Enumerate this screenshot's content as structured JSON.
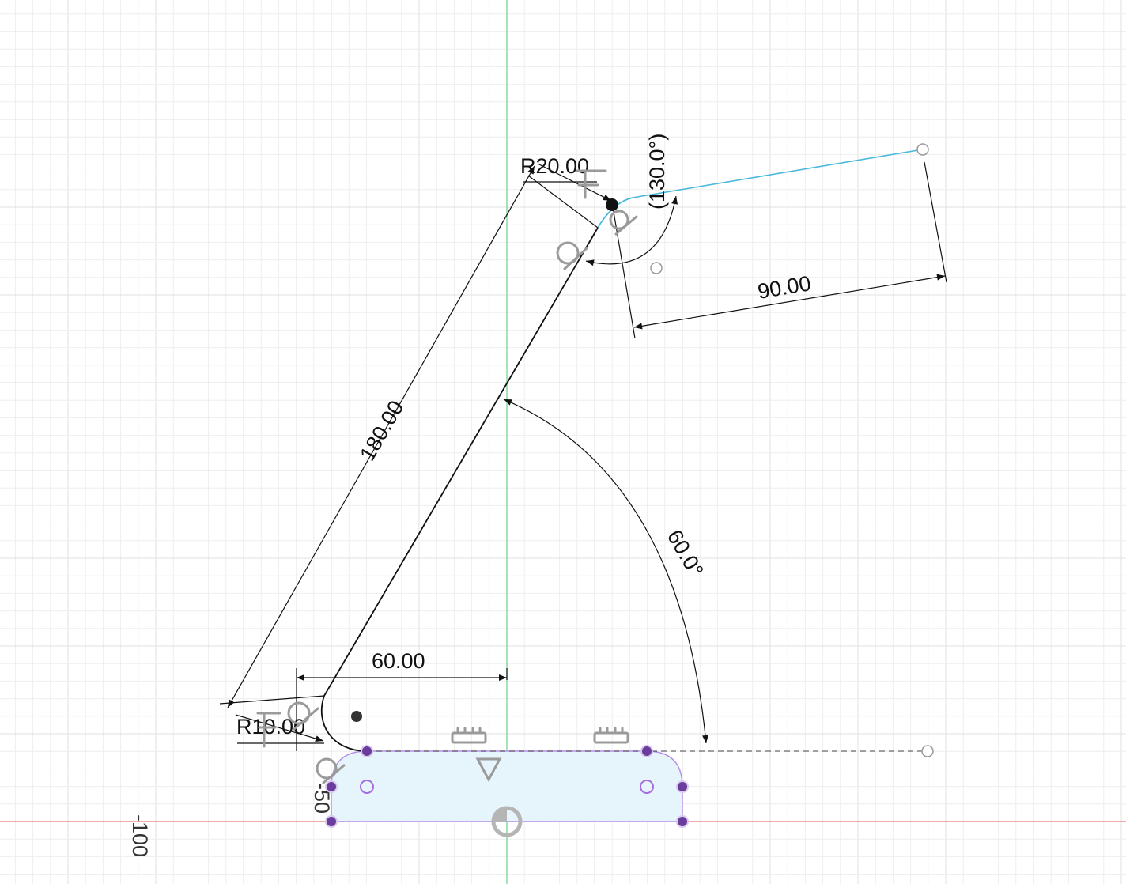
{
  "sketch": {
    "dimensions": {
      "arm_length": "180.00",
      "arm_angle": "60.0°",
      "top_angle": "(130.0°)",
      "top_radius": "R20.00",
      "bottom_radius": "R10.00",
      "offset": "60.00",
      "top_length": "90.00"
    },
    "axis_labels": {
      "minus_100": "-100",
      "minus_50": "-50"
    },
    "colors": {
      "y_axis": "#7fd99a",
      "x_axis": "#e05a5a",
      "selected_line": "#4bb8dc",
      "profile_fill": "#e6f4fc",
      "profile_edge": "#b58ee6",
      "constraint_point": "#6a3c9c",
      "sketch_line": "#111111",
      "constraint_glyph": "#9a9a9a"
    },
    "icons": [
      "coincident-constraint-icon",
      "tangent-constraint-icon",
      "horizontal-constraint-icon",
      "fix-constraint-icon",
      "origin-icon"
    ]
  }
}
